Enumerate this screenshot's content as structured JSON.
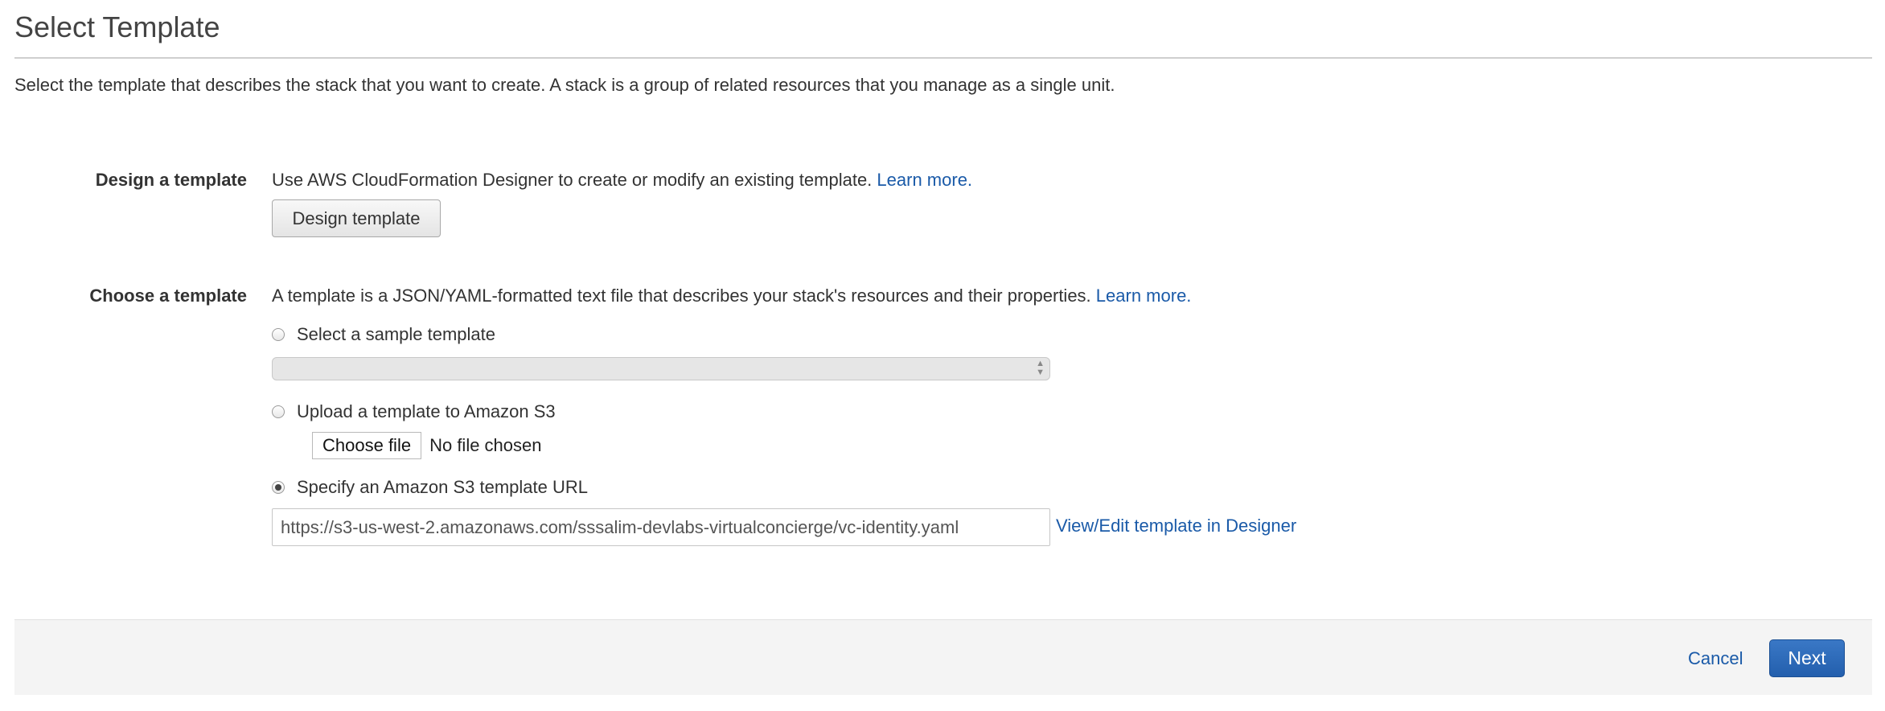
{
  "page": {
    "title": "Select Template",
    "intro": "Select the template that describes the stack that you want to create. A stack is a group of related resources that you manage as a single unit."
  },
  "design_section": {
    "label": "Design a template",
    "description": "Use AWS CloudFormation Designer to create or modify an existing template.",
    "learn_more": "Learn more.",
    "button_label": "Design template"
  },
  "choose_section": {
    "label": "Choose a template",
    "description": "A template is a JSON/YAML-formatted text file that describes your stack's resources and their properties.",
    "learn_more": "Learn more.",
    "options": [
      {
        "label": "Select a sample template",
        "checked": false
      },
      {
        "label": "Upload a template to Amazon S3",
        "checked": false
      },
      {
        "label": "Specify an Amazon S3 template URL",
        "checked": true
      }
    ],
    "sample_select_value": "",
    "choose_file_label": "Choose file",
    "no_file_text": "No file chosen",
    "template_url": "https://s3-us-west-2.amazonaws.com/sssalim-devlabs-virtualconcierge/vc-identity.yaml",
    "designer_link": "View/Edit template in Designer"
  },
  "footer": {
    "cancel_label": "Cancel",
    "next_label": "Next"
  },
  "colors": {
    "link": "#1a5aa8",
    "primary_button": "#235fad",
    "footer_bg": "#f4f4f4"
  }
}
